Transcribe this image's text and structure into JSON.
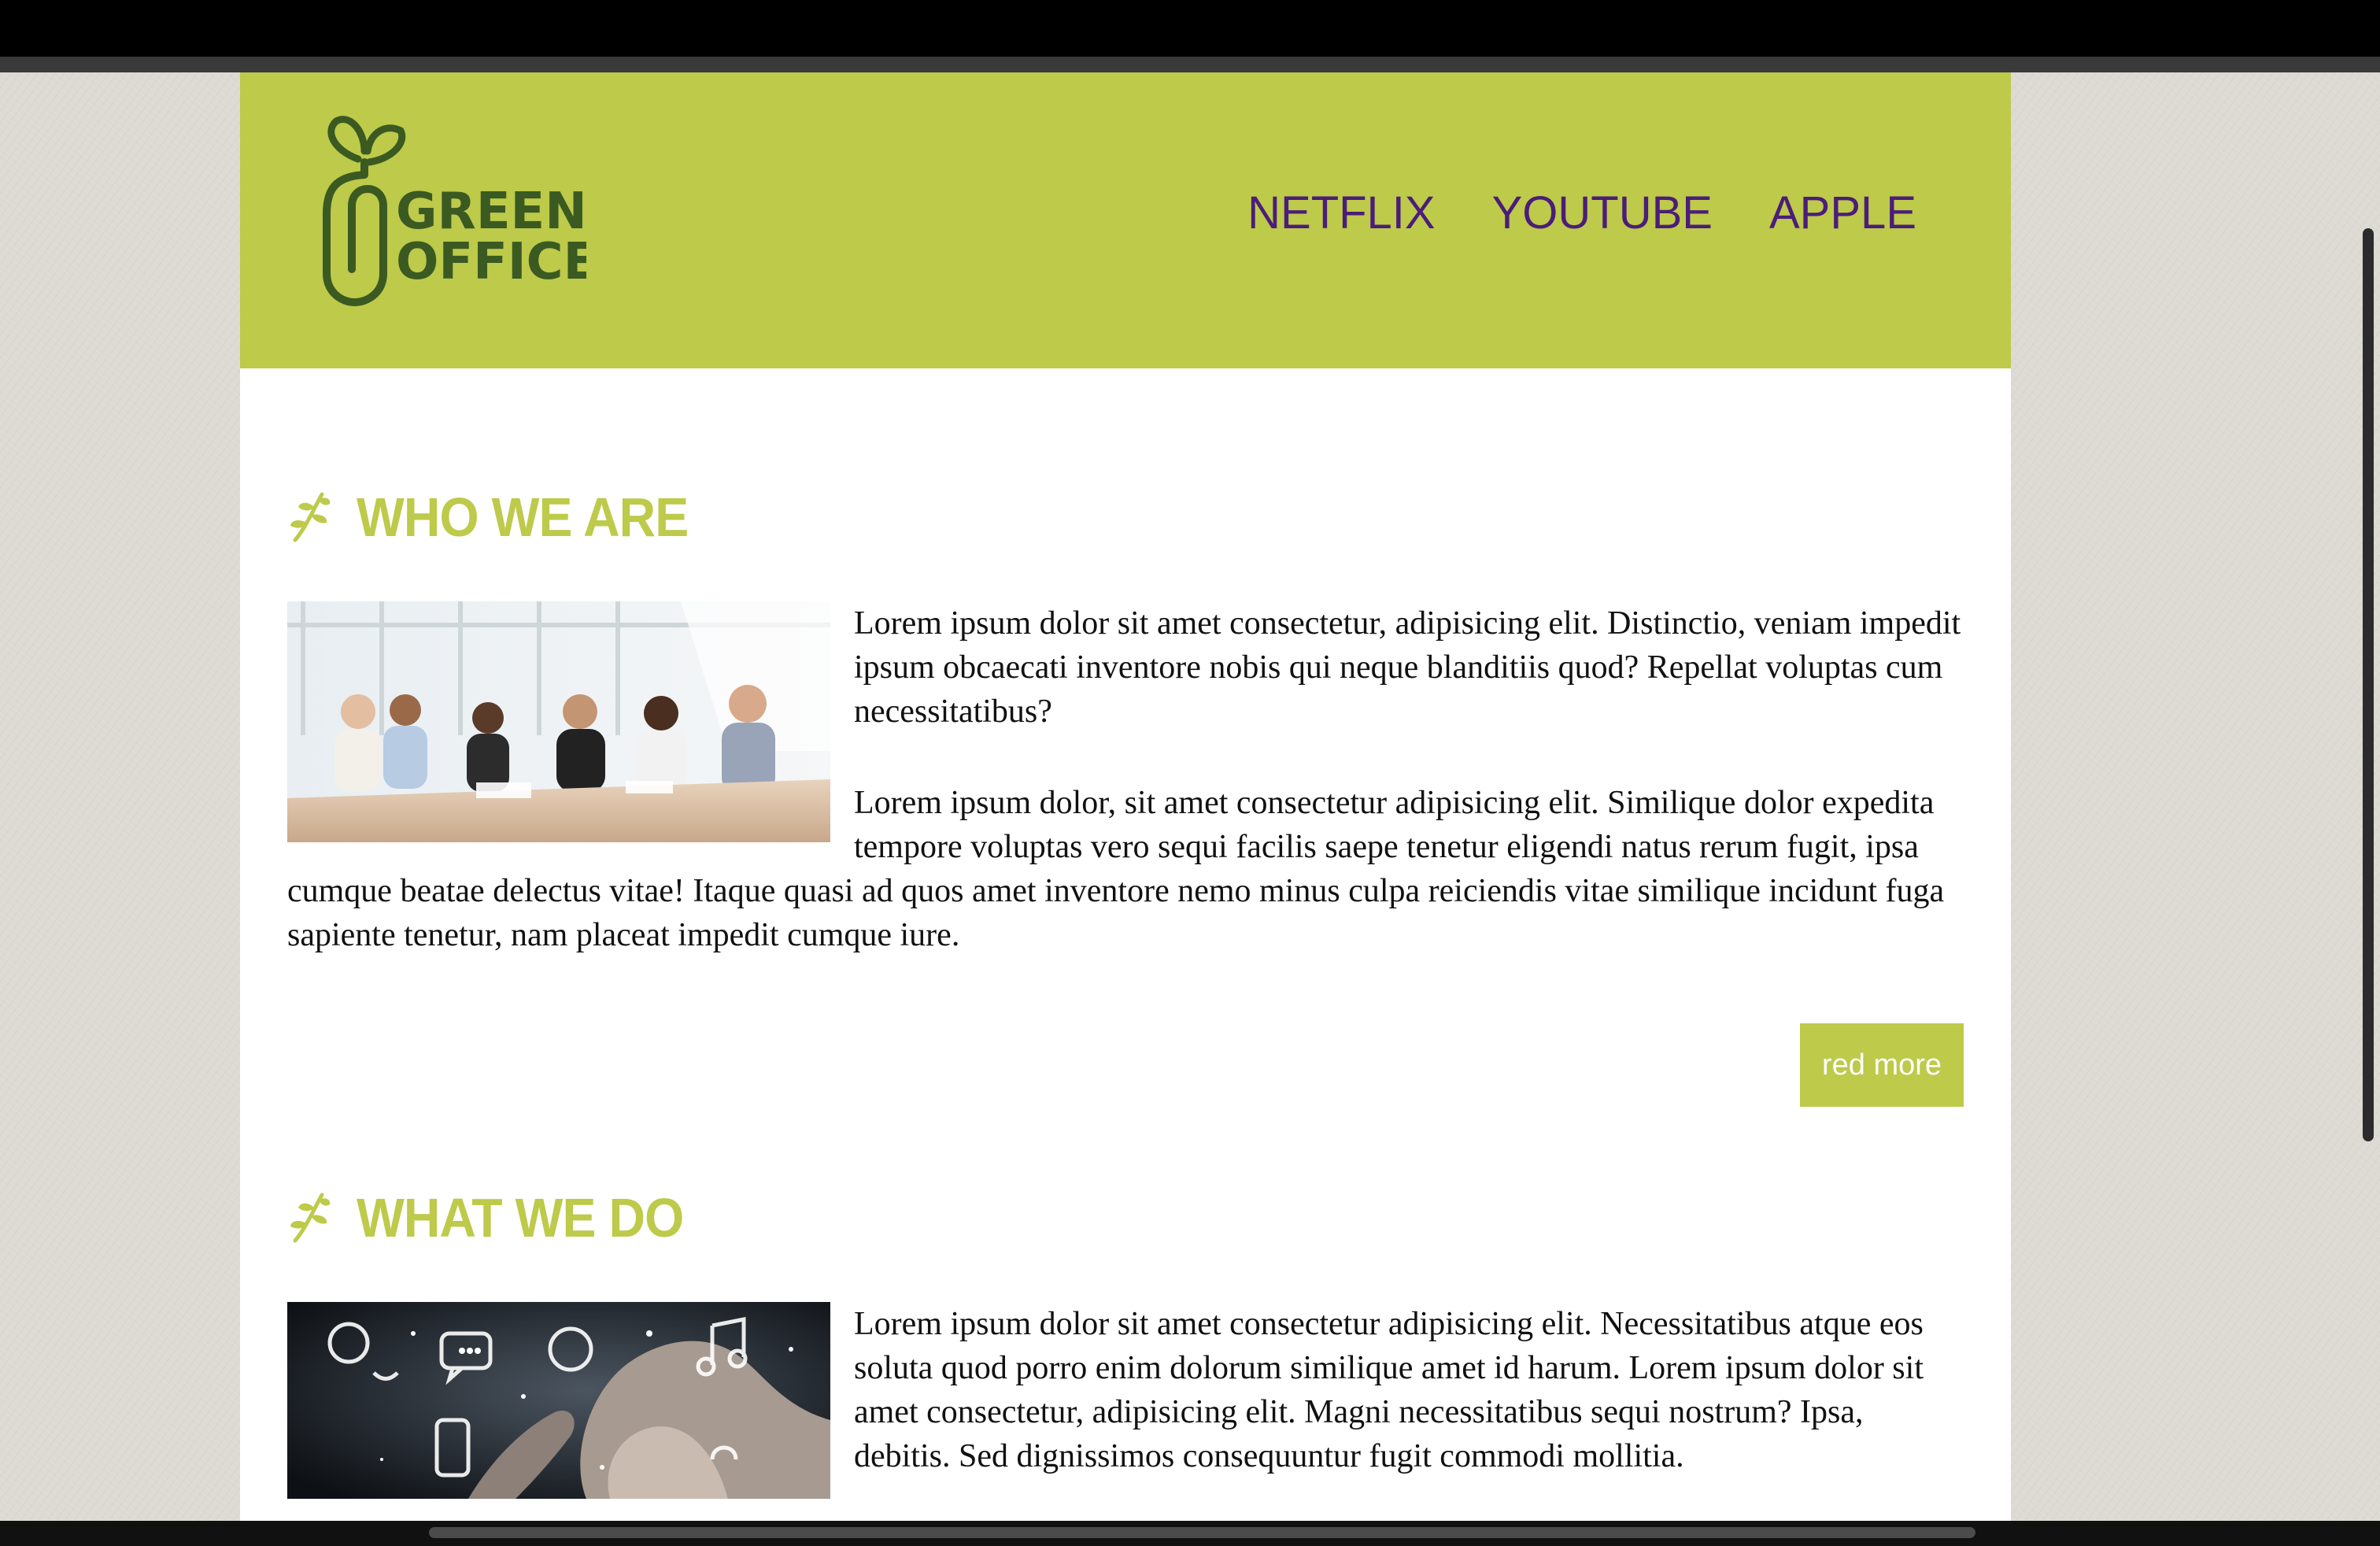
{
  "brand": {
    "line1": "GREEN",
    "line2": "OFFICE",
    "accent_color": "#bdca4a",
    "logo_color": "#3b5a22"
  },
  "nav": {
    "items": [
      {
        "label": "NETFLIX"
      },
      {
        "label": "YOUTUBE"
      },
      {
        "label": "APPLE"
      }
    ],
    "link_color": "#4b1d7a"
  },
  "sections": [
    {
      "title": "WHO WE ARE",
      "icon": "leaf-icon",
      "image": "business-team-photo",
      "paragraphs": [
        "Lorem ipsum dolor sit amet consectetur, adipisicing elit. Distinctio, veniam impedit ipsum obcaecati inventore nobis qui neque blanditiis quod? Repellat voluptas cum necessitatibus?",
        "Lorem ipsum dolor, sit amet consectetur adipisicing elit. Similique dolor expedita tempore voluptas vero sequi facilis saepe tenetur eligendi natus rerum fugit, ipsa cumque beatae delectus vitae! Itaque quasi ad quos amet inventore nemo minus culpa reiciendis vitae similique incidunt fuga sapiente tenetur, nam placeat impedit cumque iure."
      ],
      "button_label": "red more"
    },
    {
      "title": "WHAT WE DO",
      "icon": "leaf-icon",
      "image": "touchscreen-tech-photo",
      "paragraphs": [
        "Lorem ipsum dolor sit amet consectetur adipisicing elit. Necessitatibus atque eos soluta quod porro enim dolorum similique amet id harum. Lorem ipsum dolor sit amet consectetur, adipisicing elit. Magni necessitatibus sequi nostrum? Ipsa, debitis. Sed dignissimos consequuntur fugit commodi mollitia."
      ]
    }
  ]
}
